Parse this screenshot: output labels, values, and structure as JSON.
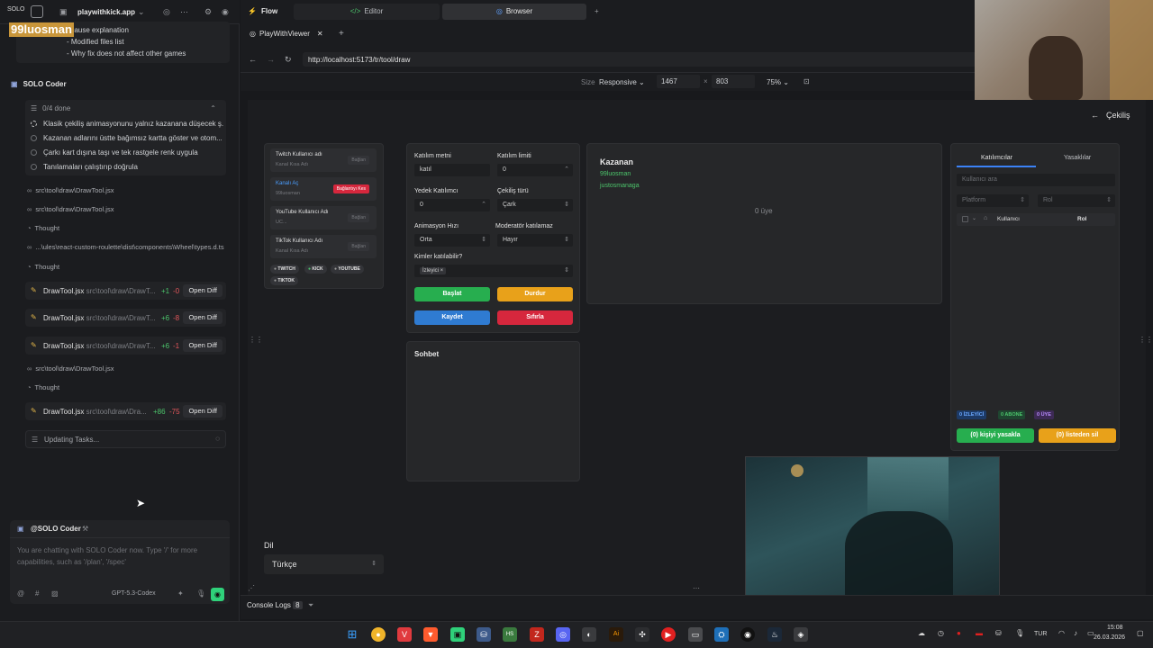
{
  "left": {
    "logo": "SOLO",
    "app_name": "playwithkick.app",
    "overlay_name": "99luosman",
    "note_lines": [
      "t cause explanation",
      "- Modified files list",
      "- Why fix does not affect other games"
    ],
    "section_title": "SOLO Coder",
    "tasks_header": "0/4 done",
    "tasks": [
      "Klasik çekiliş animasyonunu yalnız kazanana düşecek ş...",
      "Kazanan adlarını üstte bağımsız kartta göster ve otom...",
      "Çarkı kart dışına taşı ve tek rastgele renk uygula",
      "Tanılamaları çalıştırıp doğrula"
    ],
    "logs": [
      "src\\tool\\draw\\DrawTool.jsx",
      "src\\tool\\draw\\DrawTool.jsx",
      "Thought",
      "...\\ules\\react-custom-roulette\\dist\\components\\Wheel\\types.d.ts",
      "Thought",
      "src\\tool\\draw\\DrawTool.jsx",
      "Thought"
    ],
    "diffs": [
      {
        "file": "DrawTool.jsx",
        "path": "src\\tool\\draw\\DrawT...",
        "add": "+1",
        "del": "-0"
      },
      {
        "file": "DrawTool.jsx",
        "path": "src\\tool\\draw\\DrawT...",
        "add": "+6",
        "del": "-8"
      },
      {
        "file": "DrawTool.jsx",
        "path": "src\\tool\\draw\\DrawT...",
        "add": "+6",
        "del": "-1"
      },
      {
        "file": "DrawTool.jsx",
        "path": "src\\tool\\draw\\Dra...",
        "add": "+86",
        "del": "-75"
      }
    ],
    "open_diff_label": "Open Diff",
    "updating": "Updating Tasks...",
    "chat_header": "@SOLO Coder",
    "chat_placeholder_1": "You are chatting with SOLO Coder now. Type '/' for more",
    "chat_placeholder_2": "capabilities, such as '/plan', '/spec'",
    "model": "GPT-5.3-Codex"
  },
  "tabs": {
    "flow": "Flow",
    "editor": "Editor",
    "browser": "Browser",
    "viewer_tab": "PlayWithViewer",
    "plus": "+"
  },
  "url": "http://localhost:5173/tr/tool/draw",
  "size": {
    "label": "Size",
    "mode": "Responsive",
    "width": "1467",
    "height": "803",
    "zoom": "75%"
  },
  "page": {
    "back": "Çekiliş",
    "accounts": [
      {
        "title": "Twitch Kullanıcı adı",
        "sub": "Kanal Kısa Adı",
        "btn": "Bağlan"
      },
      {
        "title": "Kanalı Aç",
        "sub": "99luosman",
        "btn": "Bağlantıyı Kes"
      },
      {
        "title": "YouTube Kullanıcı Adı",
        "sub": "UC...",
        "btn": "Bağlan"
      },
      {
        "title": "TikTok Kullanıcı Adı",
        "sub": "Kanal Kısa Adı",
        "btn": "Bağlan"
      }
    ],
    "platforms": [
      "TWITCH",
      "KICK",
      "YOUTUBE",
      "TIKTOK"
    ],
    "form": {
      "join_text_label": "Katılım metni",
      "join_text": "katıl",
      "join_limit_label": "Katılım limiti",
      "join_limit": "0",
      "backup_label": "Yedek Katılımcı",
      "backup": "0",
      "draw_type_label": "Çekiliş türü",
      "draw_type": "Çark",
      "anim_label": "Animasyon Hızı",
      "anim": "Orta",
      "mod_label": "Moderatör katılamaz",
      "mod": "Hayır",
      "who_label": "Kimler katılabilir?",
      "who_chip": "İzleyici ×",
      "start": "Başlat",
      "stop": "Durdur",
      "save": "Kaydet",
      "reset": "Sıfırla"
    },
    "winner_title": "Kazanan",
    "winners": [
      "99luosman",
      "justosmanaga"
    ],
    "count_text": "0 üye",
    "chat_title": "Sohbet",
    "tab_participants": "Katılımcılar",
    "tab_bans": "Yasaklılar",
    "search_placeholder": "Kullanıcı ara",
    "platform_select": "Platform",
    "role_select": "Rol",
    "col_user": "Kullanıcı",
    "col_role": "Rol",
    "stats": {
      "viewer": "0 İZLEYİCİ",
      "sub": "0 ABONE",
      "member": "0 ÜYE"
    },
    "ban_btn": "(0) kişiyi yasakla",
    "remove_btn": "(0) listeden sil",
    "lang_label": "Dil",
    "lang_value": "Türkçe"
  },
  "bottom": {
    "console": "Console Logs",
    "count": "8"
  },
  "taskbar": {
    "lang": "TUR",
    "time": "15:08",
    "date": "26.03.2026"
  },
  "colors": {
    "green": "#27ae4f",
    "orange": "#e8a11a",
    "blue": "#2f7bd1",
    "red": "#d6273d",
    "accent_blue": "#3b82f6"
  }
}
